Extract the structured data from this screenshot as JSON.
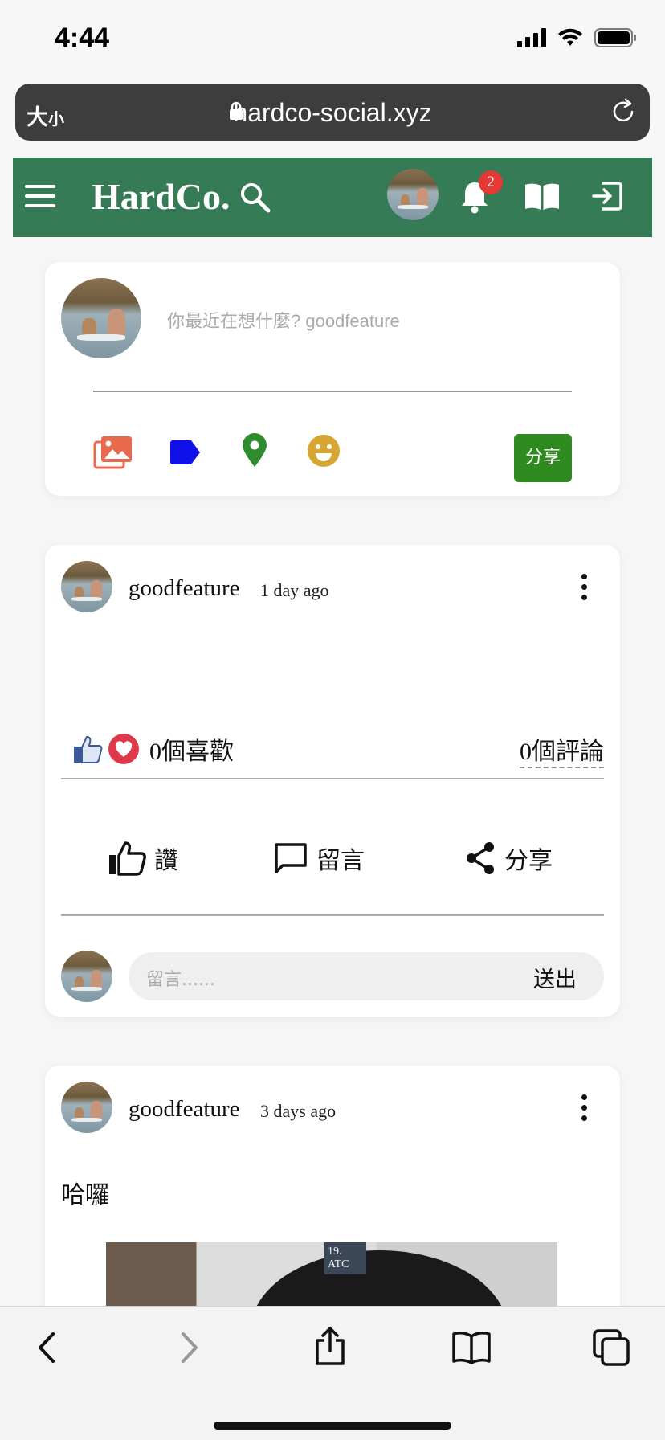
{
  "status_bar": {
    "time": "4:44"
  },
  "browser": {
    "text_size_label": "大",
    "text_size_small": "小",
    "url": "hardco-social.xyz"
  },
  "navbar": {
    "brand": "HardCo.",
    "notification_count": "2"
  },
  "composer": {
    "placeholder": "你最近在想什麼? goodfeature",
    "share_label": "分享",
    "tool_colors": {
      "photo": "#e86a4e",
      "tag": "#1010e8",
      "location": "#2e8b2e",
      "feeling": "#d6a532"
    }
  },
  "posts": [
    {
      "author": "goodfeature",
      "time": "1 day ago",
      "text": "",
      "likes_label": "0個喜歡",
      "comments_label": "0個評論",
      "actions": {
        "like": "讚",
        "comment": "留言",
        "share": "分享"
      },
      "comment_placeholder": "留言......",
      "send_label": "送出"
    },
    {
      "author": "goodfeature",
      "time": "3 days ago",
      "text": "哈囉",
      "photo_tag": "19. ATC"
    }
  ],
  "colors": {
    "navbar": "#347b56",
    "share_button": "#2f8a1f",
    "badge": "#e53935"
  }
}
